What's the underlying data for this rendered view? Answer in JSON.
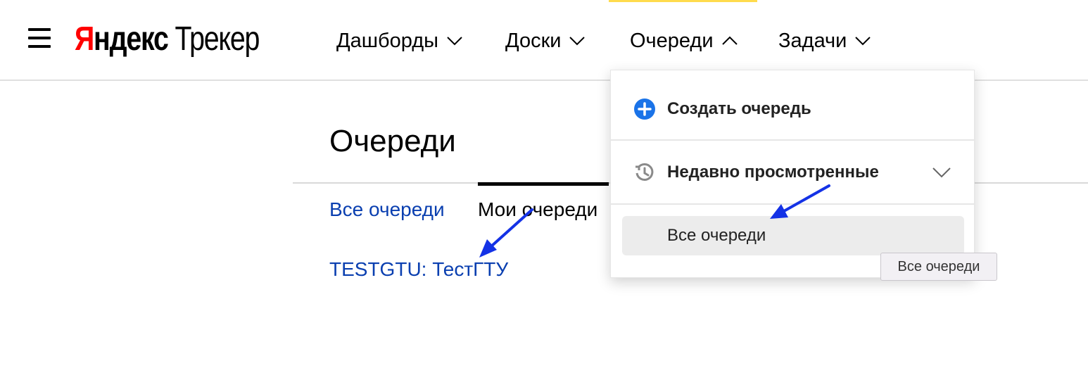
{
  "header": {
    "logo": {
      "brand_first": "Я",
      "brand_rest": "ндекс",
      "product": "Трекер"
    },
    "nav": [
      {
        "label": "Дашборды",
        "state": "collapsed"
      },
      {
        "label": "Доски",
        "state": "collapsed"
      },
      {
        "label": "Очереди",
        "state": "expanded"
      },
      {
        "label": "Задачи",
        "state": "collapsed"
      }
    ],
    "active_color": "#ffdb4d"
  },
  "main": {
    "title": "Очереди",
    "tabs": [
      {
        "label": "Все очереди"
      },
      {
        "label": "Мои очереди",
        "active": true
      }
    ],
    "queues": [
      {
        "label": "TESTGTU: ТестГТУ"
      }
    ],
    "link_color": "#0a3fb0"
  },
  "dropdown": {
    "create_label": "Создать очередь",
    "recent_label": "Недавно просмотренные",
    "all_label": "Все очереди",
    "create_icon": "plus-circle-icon",
    "recent_icon": "history-icon",
    "accent_color": "#1a73e8"
  },
  "tooltip": {
    "text": "Все очереди"
  },
  "annotations": {
    "arrow_color": "#1432e6"
  }
}
